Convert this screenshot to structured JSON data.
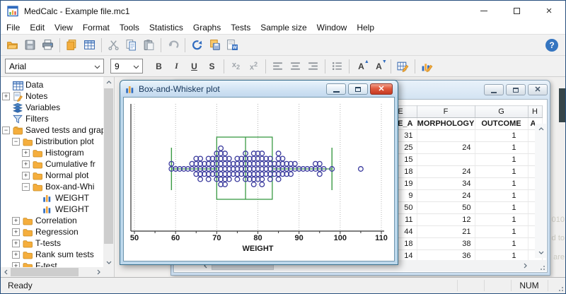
{
  "window": {
    "title": "MedCalc - Example file.mc1"
  },
  "menu": {
    "items": [
      "File",
      "Edit",
      "View",
      "Format",
      "Tools",
      "Statistics",
      "Graphs",
      "Tests",
      "Sample size",
      "Window",
      "Help"
    ]
  },
  "toolbar": {
    "buttons": [
      "open",
      "save",
      "print",
      "|",
      "copy-sheets",
      "grid",
      "|",
      "cut",
      "copy",
      "paste",
      "|",
      "undo",
      "|",
      "refresh",
      "save-all",
      "export-doc"
    ],
    "help_label": "?"
  },
  "formatbar": {
    "font": "Arial",
    "size": "9",
    "buttons": [
      "bold",
      "italic",
      "underline",
      "strike",
      "|",
      "subscript",
      "superscript",
      "|",
      "align-left",
      "align-center",
      "align-right",
      "|",
      "list",
      "|",
      "font-increase",
      "font-decrease",
      "|",
      "edit-table",
      "|",
      "edit-chart"
    ]
  },
  "tree": {
    "items": [
      {
        "label": "Data",
        "level": 0,
        "icon": "table",
        "expand": null
      },
      {
        "label": "Notes",
        "level": 0,
        "icon": "notes",
        "expand": "+"
      },
      {
        "label": "Variables",
        "level": 0,
        "icon": "layers",
        "expand": null
      },
      {
        "label": "Filters",
        "level": 0,
        "icon": "funnel",
        "expand": null
      },
      {
        "label": "Saved tests and grap",
        "level": 0,
        "icon": "folders",
        "expand": "-"
      },
      {
        "label": "Distribution plot",
        "level": 1,
        "icon": "folder",
        "expand": "-"
      },
      {
        "label": "Histogram",
        "level": 2,
        "icon": "folder",
        "expand": "+"
      },
      {
        "label": "Cumulative fr",
        "level": 2,
        "icon": "folder",
        "expand": "+"
      },
      {
        "label": "Normal plot",
        "level": 2,
        "icon": "folder",
        "expand": "+"
      },
      {
        "label": "Box-and-Whi",
        "level": 2,
        "icon": "folder",
        "expand": "-"
      },
      {
        "label": "WEIGHT",
        "level": 3,
        "icon": "chart",
        "expand": null
      },
      {
        "label": "WEIGHT",
        "level": 3,
        "icon": "chart",
        "expand": null
      },
      {
        "label": "Correlation",
        "level": 1,
        "icon": "folder",
        "expand": "+"
      },
      {
        "label": "Regression",
        "level": 1,
        "icon": "folder",
        "expand": "+"
      },
      {
        "label": "T-tests",
        "level": 1,
        "icon": "folder",
        "expand": "+"
      },
      {
        "label": "Rank sum tests",
        "level": 1,
        "icon": "folder",
        "expand": "+"
      },
      {
        "label": "F-test",
        "level": 1,
        "icon": "folder",
        "expand": "+"
      }
    ]
  },
  "plot_window": {
    "title": "Box-and-Whisker plot"
  },
  "chart_data": {
    "type": "boxplot-dot",
    "title": "Box-and-Whisker plot",
    "xlabel": "WEIGHT",
    "xlim": [
      50,
      110
    ],
    "xticks": [
      50,
      60,
      70,
      80,
      90,
      100,
      110
    ],
    "grid": "vertical-dotted",
    "box": {
      "lower_whisker": 59,
      "q1": 70,
      "median": 77,
      "q3": 83.5,
      "upper_whisker": 98
    },
    "outliers": [
      105
    ],
    "dot_counts": [
      [
        59,
        2
      ],
      [
        60,
        1
      ],
      [
        61,
        1
      ],
      [
        62,
        1
      ],
      [
        63,
        1
      ],
      [
        64,
        2
      ],
      [
        65,
        4
      ],
      [
        66,
        5
      ],
      [
        67,
        3
      ],
      [
        68,
        5
      ],
      [
        69,
        4
      ],
      [
        70,
        6
      ],
      [
        71,
        8
      ],
      [
        72,
        7
      ],
      [
        73,
        5
      ],
      [
        74,
        3
      ],
      [
        75,
        5
      ],
      [
        76,
        4
      ],
      [
        77,
        6
      ],
      [
        78,
        5
      ],
      [
        79,
        7
      ],
      [
        80,
        6
      ],
      [
        81,
        7
      ],
      [
        82,
        4
      ],
      [
        83,
        5
      ],
      [
        84,
        3
      ],
      [
        85,
        6
      ],
      [
        86,
        4
      ],
      [
        87,
        3
      ],
      [
        88,
        3
      ],
      [
        89,
        2
      ],
      [
        90,
        1
      ],
      [
        91,
        1
      ],
      [
        92,
        1
      ],
      [
        93,
        1
      ],
      [
        94,
        2
      ],
      [
        95,
        3
      ],
      [
        96,
        1
      ],
      [
        98,
        1
      ]
    ]
  },
  "data_window": {
    "columns": [
      "E",
      "F",
      "G",
      "H"
    ],
    "name_row": [
      "DE_A",
      "MORPHOLOGY",
      "OUTCOME",
      "A"
    ],
    "rows": [
      [
        "31",
        "",
        "1",
        ""
      ],
      [
        "25",
        "24",
        "1",
        ""
      ],
      [
        "15",
        "",
        "1",
        ""
      ],
      [
        "18",
        "24",
        "1",
        ""
      ],
      [
        "19",
        "34",
        "1",
        ""
      ],
      [
        "9",
        "24",
        "1",
        ""
      ],
      [
        "50",
        "50",
        "1",
        ""
      ],
      [
        "11",
        "12",
        "1",
        ""
      ],
      [
        "44",
        "21",
        "1",
        ""
      ],
      [
        "18",
        "38",
        "1",
        ""
      ],
      [
        "14",
        "36",
        "1",
        ""
      ]
    ]
  },
  "statusbar": {
    "ready": "Ready",
    "num": "NUM"
  },
  "watermark": {
    "fragments": [
      "010",
      "d to",
      "are"
    ]
  },
  "colors": {
    "accent_active_frame": "#39708e",
    "chart_green": "#3a9a44",
    "chart_dot": "#3b3b9e",
    "folder_orange": "#f5ae3d",
    "help_blue": "#3575c0",
    "titlebar_gradient_top": "#eaf4fc"
  }
}
